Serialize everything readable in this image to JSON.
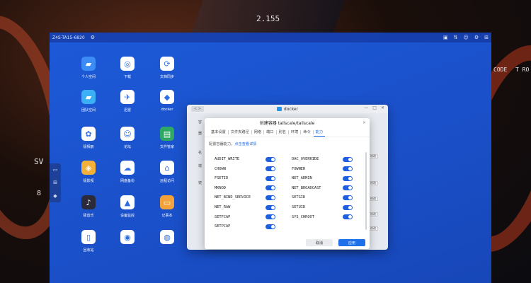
{
  "background": {
    "text_2155": "2.155",
    "text_code": "CODE",
    "text_tro": "T RO",
    "text_sv": "SV",
    "text_8": "8"
  },
  "nas": {
    "device_name": "Z4S-TA15-6820",
    "desktop_icons": [
      {
        "label": "个人空间",
        "icon": "folder-icon",
        "color": "#3b8cf5"
      },
      {
        "label": "下载",
        "icon": "download-icon",
        "color": "#ffffff"
      },
      {
        "label": "文档同步",
        "icon": "sync-icon",
        "color": "#ffffff"
      },
      {
        "label": "团队空间",
        "icon": "team-folder-icon",
        "color": "#3bb0f5"
      },
      {
        "label": "迅雷",
        "icon": "thunder-icon",
        "color": "#ffffff"
      },
      {
        "label": "docker",
        "icon": "docker-icon",
        "color": "#ffffff"
      },
      {
        "label": "极相册",
        "icon": "photos-icon",
        "color": "#ffffff"
      },
      {
        "label": "论坛",
        "icon": "forum-icon",
        "color": "#ffffff"
      },
      {
        "label": "文件管家",
        "icon": "file-manager-icon",
        "color": "#2fa864"
      },
      {
        "label": "极影视",
        "icon": "video-icon",
        "color": "#f4b13a"
      },
      {
        "label": "网盘备份",
        "icon": "cloud-backup-icon",
        "color": "#ffffff"
      },
      {
        "label": "远程访问",
        "icon": "remote-access-icon",
        "color": "#ffffff"
      },
      {
        "label": "极音乐",
        "icon": "music-icon",
        "color": "#2a2a3a"
      },
      {
        "label": "设备监控",
        "icon": "monitor-icon",
        "color": "#ffffff"
      },
      {
        "label": "记事本",
        "icon": "notepad-icon",
        "color": "#f4a13a"
      },
      {
        "label": "回收站",
        "icon": "trash-icon",
        "color": "#ffffff"
      },
      {
        "label": "",
        "icon": "disk-icon",
        "color": "#ffffff"
      },
      {
        "label": "",
        "icon": "safe-icon",
        "color": "#ffffff"
      }
    ]
  },
  "docker": {
    "title": "docker",
    "nav_label": "<   >",
    "side_hint_1": "容",
    "side_hint_2": "器",
    "side_hint_3": "名",
    "side_hint_4": "端",
    "side_hint_5": "镜",
    "right_btn_label": "修改"
  },
  "modal": {
    "title": "创建容器 tailscale/tailscale",
    "close": "×",
    "tabs": [
      "基本设置",
      "文件夹路径",
      "网络",
      "端口",
      "别名",
      "环境",
      "命令",
      "能力"
    ],
    "active_tab": "能力",
    "hint_prefix": "配置容器能力，",
    "hint_link": "点击查看详情",
    "caps_left": [
      "AUDIT_WRITE",
      "CHOWN",
      "FSETID",
      "MKNOD",
      "NET_BIND_SERVICE",
      "NET_RAW",
      "SETFCAP",
      "SETPCAP"
    ],
    "caps_right": [
      "DAC_OVERRIDE",
      "FOWNER",
      "NET_ADMIN",
      "NET_BROADCAST",
      "SETGID",
      "SETUID",
      "SYS_CHROOT"
    ],
    "cancel_label": "取消",
    "ok_label": "应用",
    "toggle_color": "#1e5fe0"
  }
}
